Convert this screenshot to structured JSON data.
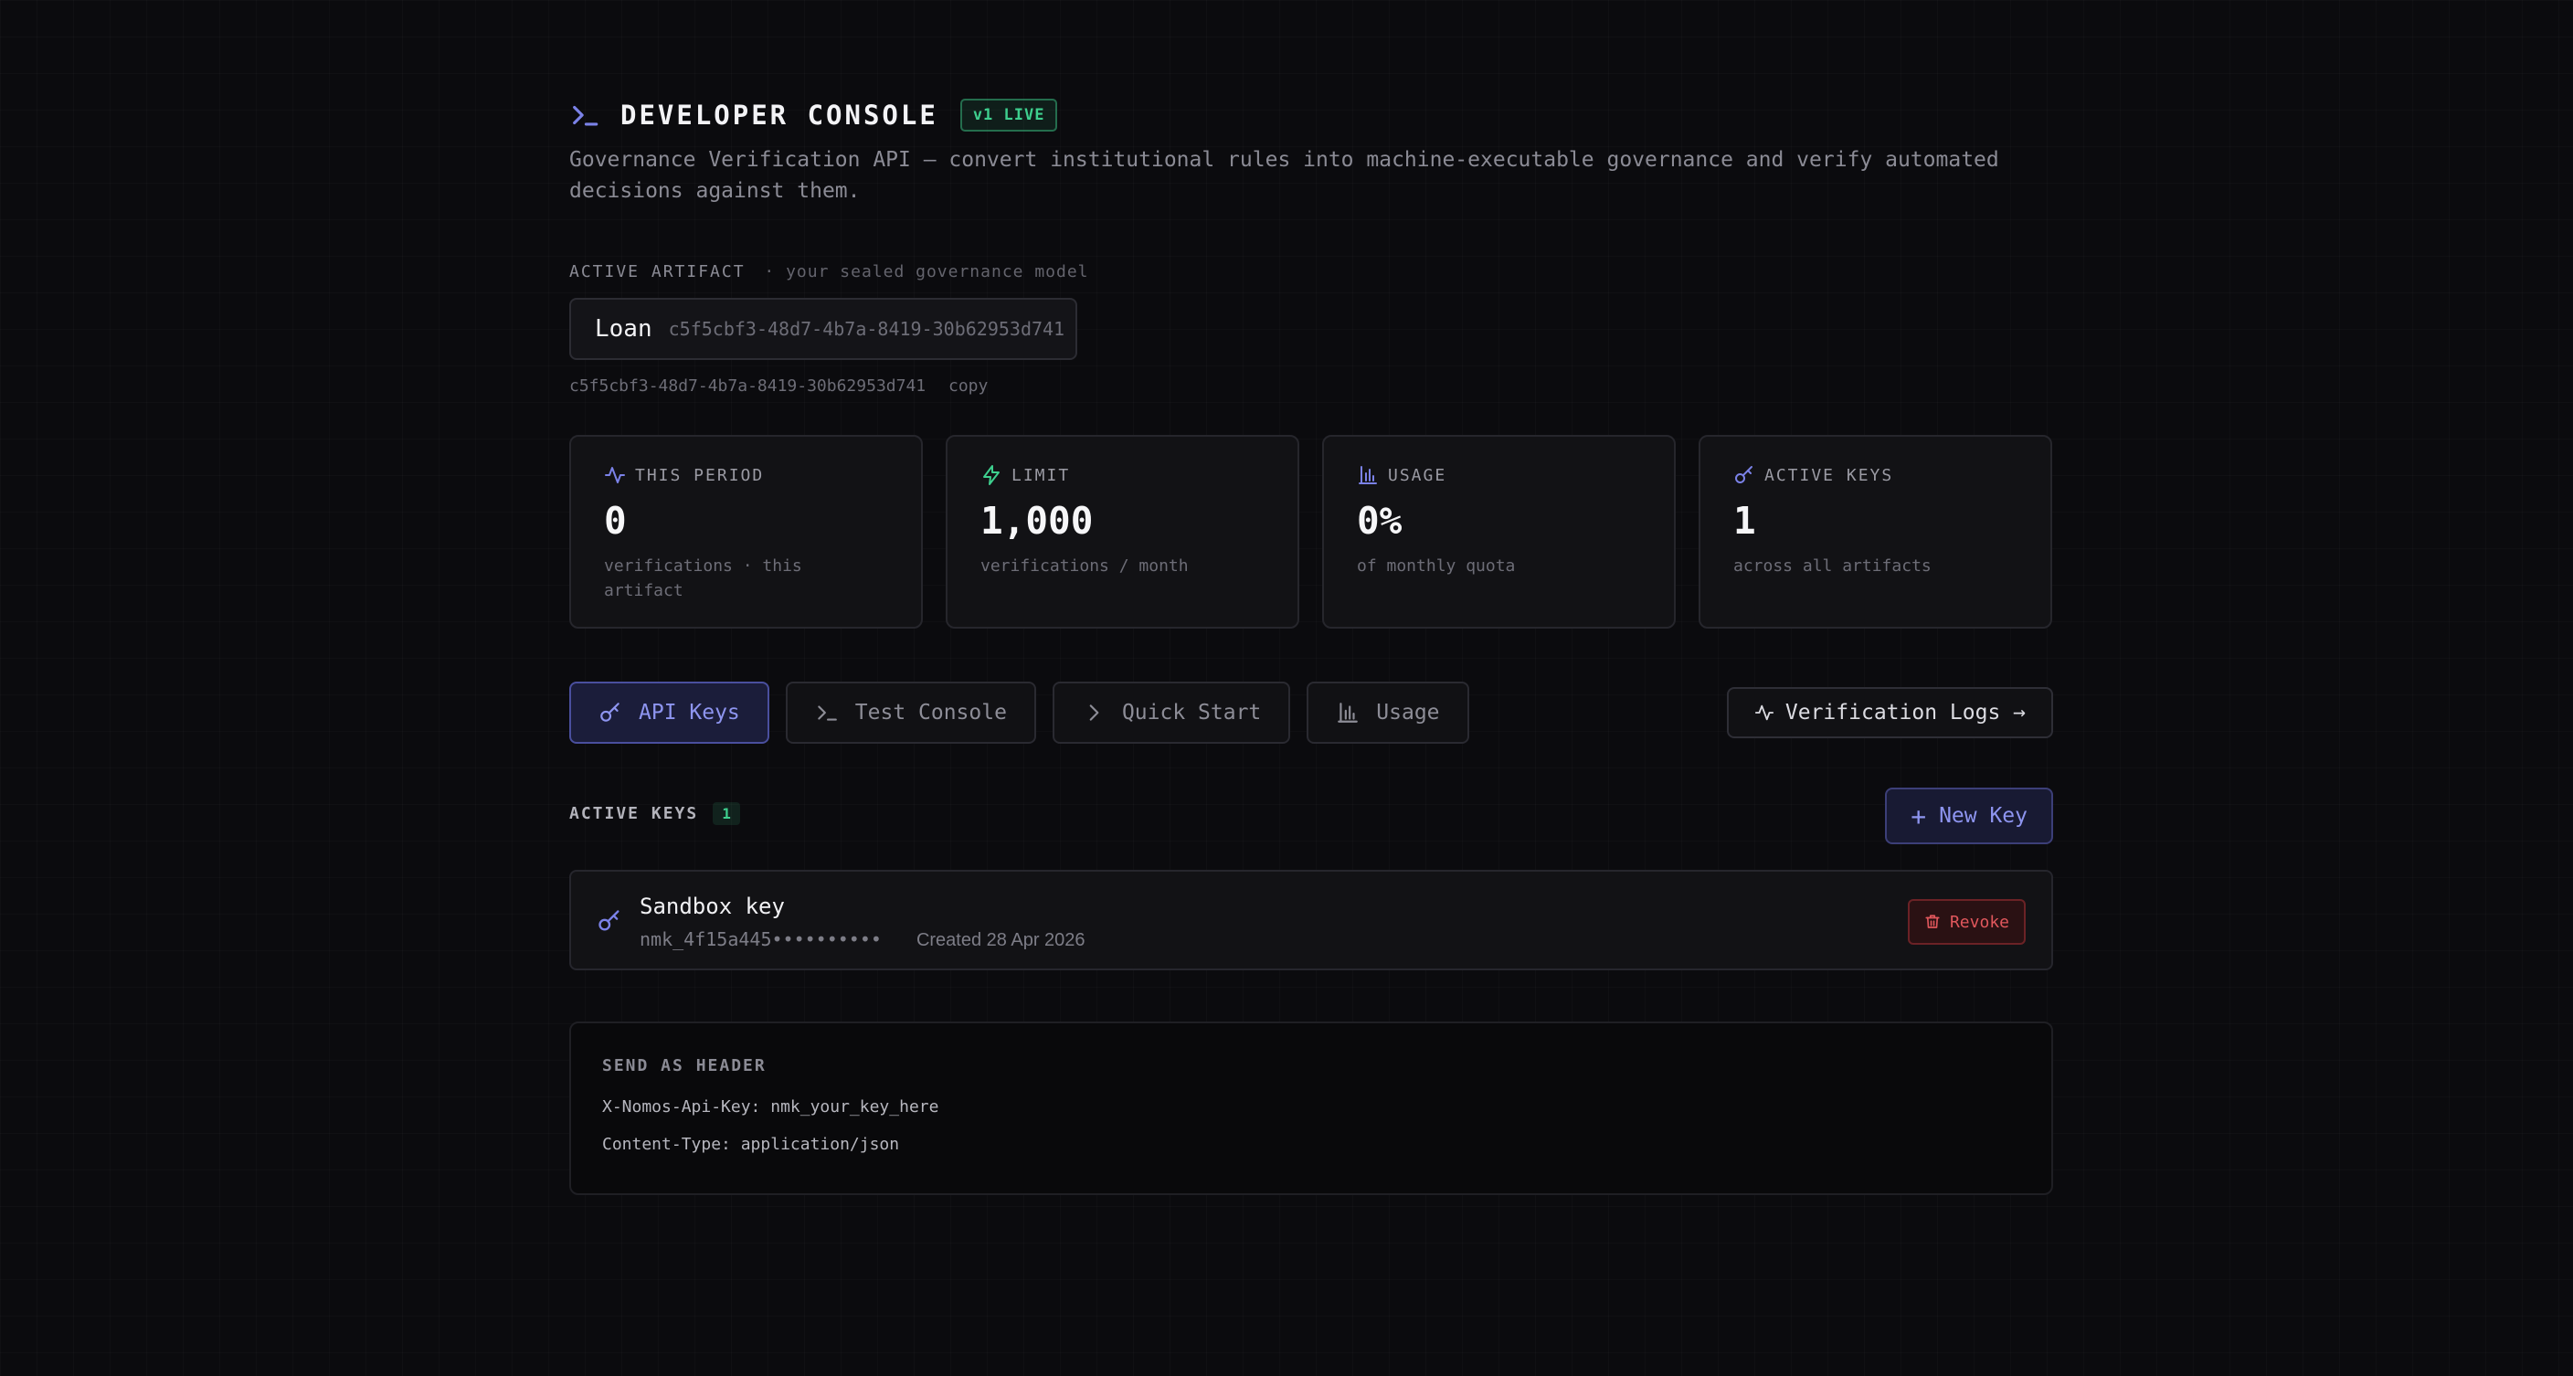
{
  "header": {
    "title": "DEVELOPER CONSOLE",
    "badge": "v1 LIVE",
    "description": "Governance Verification API — convert institutional rules into machine-executable governance and verify automated decisions against them."
  },
  "artifact": {
    "section_label": "ACTIVE ARTIFACT",
    "section_sub": "· your sealed governance model",
    "name": "Loan",
    "id": "c5f5cbf3-48d7-4b7a-8419-30b62953d741",
    "copy_label": "copy"
  },
  "stats": [
    {
      "icon": "activity-icon",
      "label": "THIS PERIOD",
      "value": "0",
      "note": "verifications · this artifact"
    },
    {
      "icon": "lightning-icon",
      "label": "LIMIT",
      "value": "1,000",
      "note": "verifications / month"
    },
    {
      "icon": "bar-chart-icon",
      "label": "USAGE",
      "value": "0%",
      "note": "of monthly quota"
    },
    {
      "icon": "key-icon",
      "label": "ACTIVE KEYS",
      "value": "1",
      "note": "across all artifacts"
    }
  ],
  "tabs": [
    {
      "icon": "key-icon",
      "label": "API Keys",
      "active": true
    },
    {
      "icon": "terminal-icon",
      "label": "Test Console",
      "active": false
    },
    {
      "icon": "chevron-right-icon",
      "label": "Quick Start",
      "active": false
    },
    {
      "icon": "bar-chart-icon",
      "label": "Usage",
      "active": false
    }
  ],
  "logs_button": "Verification Logs →",
  "keys": {
    "heading": "ACTIVE KEYS",
    "count": "1",
    "new_key_label": "New Key",
    "items": [
      {
        "name": "Sandbox key",
        "masked": "nmk_4f15a445••••••••••",
        "created": "Created 28 Apr 2026",
        "revoke_label": "Revoke"
      }
    ]
  },
  "send_header": {
    "label": "SEND AS HEADER",
    "lines": [
      "X-Nomos-Api-Key: nmk_your_key_here",
      "Content-Type: application/json"
    ]
  },
  "colors": {
    "accent": "#8e95f0",
    "success": "#3ecf8e",
    "danger": "#e0575c",
    "background": "#0b0b0e"
  }
}
